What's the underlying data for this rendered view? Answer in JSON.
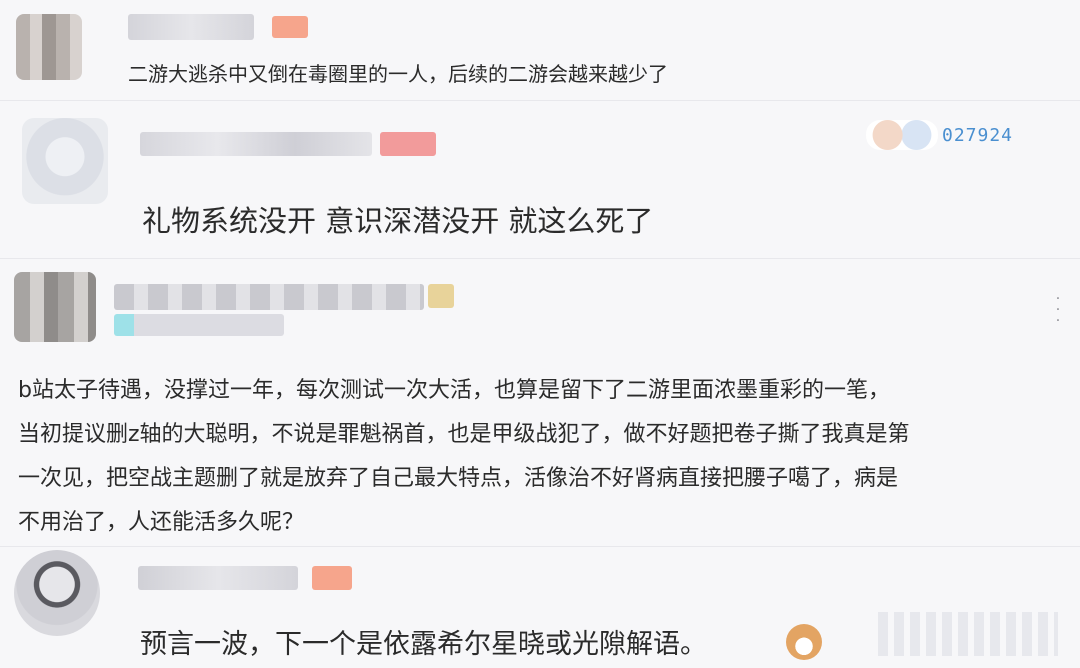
{
  "comments": [
    {
      "text": "二游大逃杀中又倒在毒圈里的一人，后续的二游会越来越少了"
    },
    {
      "text": "礼物系统没开 意识深潜没开 就这么死了",
      "sticker_code": "027924"
    },
    {
      "lines": [
        "b站太子待遇，没撑过一年，每次测试一次大活，也算是留下了二游里面浓墨重彩的一笔，",
        "当初提议删z轴的大聪明，不说是罪魁祸首，也是甲级战犯了，做不好题把卷子撕了我真是第",
        "一次见，把空战主题删了就是放弃了自己最大特点，活像治不好肾病直接把腰子噶了，病是",
        "不用治了，人还能活多久呢？"
      ]
    },
    {
      "text": "预言一波，下一个是依露希尔星晓或光隙解语。"
    }
  ],
  "colors": {
    "background": "#f7f7f9",
    "text": "#2b2b2b",
    "level_badge": "#f6a58c",
    "sticker_digits": "#4a8fd0"
  },
  "icons": {
    "more": "more-vertical-icon",
    "emoji": "shiba-dog-emoji-icon"
  }
}
